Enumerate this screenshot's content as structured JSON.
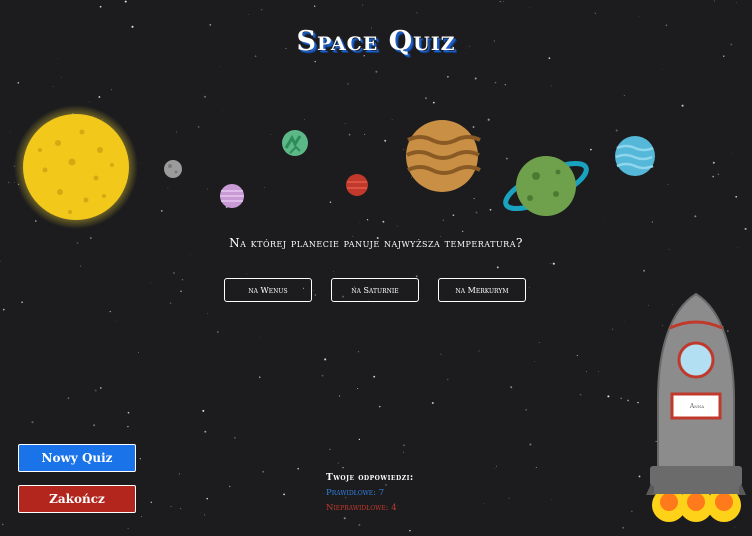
{
  "title": "Space Quiz",
  "question": "Na której planecie panuje najwyższa temperatura?",
  "answers": [
    "na Wenus",
    "na Saturnie",
    "na Merkurym"
  ],
  "buttons": {
    "new_quiz": "Nowy Quiz",
    "end": "Zakończ"
  },
  "score": {
    "title": "Twoje odpowiedzi:",
    "correct": "Prawidłowe: 7",
    "wrong": "Nieprawidłowe: 4"
  },
  "player_name": "Anna",
  "colors": {
    "correct": "#2f7fe0",
    "wrong": "#c03a2b",
    "new_quiz_button": "#1a73e8",
    "end_button": "#b3261e"
  }
}
